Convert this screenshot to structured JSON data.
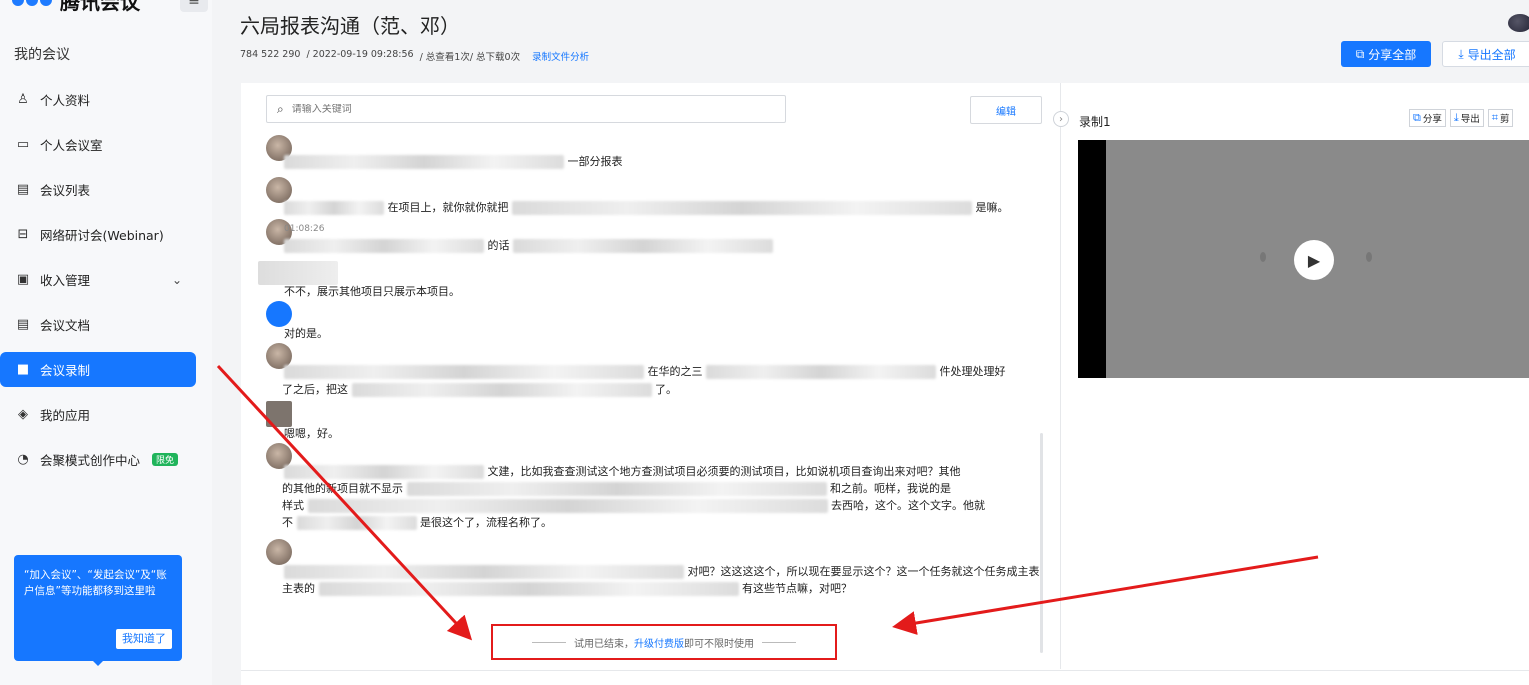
{
  "app": {
    "brand": "腾讯会议"
  },
  "sidebar": {
    "section_title": "我的会议",
    "items": [
      {
        "label": "个人资料",
        "icon": "user-icon"
      },
      {
        "label": "个人会议室",
        "icon": "monitor-icon"
      },
      {
        "label": "会议列表",
        "icon": "list-icon"
      },
      {
        "label": "网络研讨会(Webinar)",
        "icon": "webinar-icon"
      },
      {
        "label": "收入管理",
        "icon": "wallet-icon"
      },
      {
        "label": "会议文档",
        "icon": "document-icon"
      },
      {
        "label": "会议录制",
        "icon": "camera-icon"
      },
      {
        "label": "我的应用",
        "icon": "layers-icon"
      },
      {
        "label": "会聚模式创作中心",
        "icon": "creation-icon",
        "badge": "限免"
      }
    ],
    "tip": {
      "text": "“加入会议”、“发起会议”及“账户信息”等功能都移到这里啦",
      "button": "我知道了"
    }
  },
  "header": {
    "title": "六局报表沟通（范、邓）",
    "meta_id": "784 522 290",
    "meta_date": "/ 2022-09-19 09:28:56",
    "meta_stats": "/ 总查看1次/ 总下载0次",
    "meta_link": "录制文件分析",
    "share_all": "分享全部",
    "export_all": "导出全部"
  },
  "transcript": {
    "search_placeholder": "请输入关键词",
    "edit_button": "编辑",
    "messages": [
      {
        "text": "一部分报表"
      },
      {
        "text": "在项目上，就你就你就把",
        "tail": "是嘛。"
      },
      {
        "time": "01:08:26",
        "text": "的话"
      },
      {
        "text": "不不，展示其他项目只展示本项目。"
      },
      {
        "text": "对的是。"
      },
      {
        "text": "在华的之三",
        "tail": "件处理处理好",
        "line2": "了之后，把这",
        "line2_tail": "了。"
      },
      {
        "text": "嗯嗯，好。"
      },
      {
        "text": "文建，比如我查查测试这个地方查测试项目必须要的测试项目，比如说机项目查询出来对吧？其他",
        "line2": "的其他的新项目就不显示",
        "line2_tail": "和之前。呃样，我说的是",
        "line3": "样式",
        "line3_tail": "去西哈，这个。这个文字。他就",
        "line4": "不",
        "line4_tail": "是很这个了，流程名称了。"
      },
      {
        "text": "对吧？这这这这个，所以现在要显示这个？这一个任务就这个任务成主表",
        "line2": "主表的",
        "line2_tail": "有这些节点嘛，对吧？"
      }
    ],
    "trial_prefix": "试用已结束，",
    "trial_link": "升级付费版",
    "trial_suffix": "即可不限时使用"
  },
  "recording": {
    "title": "录制1",
    "share": "分享",
    "export": "导出",
    "crop": "剪"
  }
}
